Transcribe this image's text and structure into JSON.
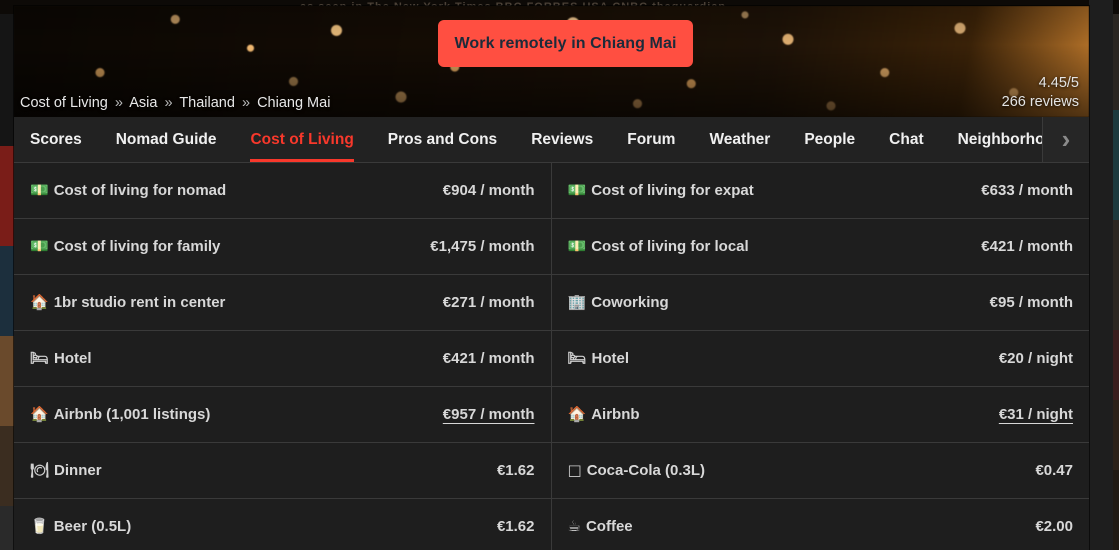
{
  "background": {
    "press_logos": "as seen in   The New York Times   BBC   FORBES   USA   CNBC   theguardian"
  },
  "hero": {
    "cta_label": "Work remotely in Chiang Mai",
    "cta_color": "#ff4f41",
    "breadcrumb": [
      {
        "label": "Cost of Living"
      },
      {
        "label": "Asia"
      },
      {
        "label": "Thailand"
      },
      {
        "label": "Chiang Mai"
      }
    ],
    "breadcrumb_separator": "»",
    "rating_score": "4.45/5",
    "rating_reviews": "266 reviews"
  },
  "tabs": {
    "accent_color": "#f8382b",
    "items": [
      {
        "label": "Scores",
        "active": false
      },
      {
        "label": "Nomad Guide",
        "active": false
      },
      {
        "label": "Cost of Living",
        "active": true
      },
      {
        "label": "Pros and Cons",
        "active": false
      },
      {
        "label": "Reviews",
        "active": false
      },
      {
        "label": "Forum",
        "active": false
      },
      {
        "label": "Weather",
        "active": false
      },
      {
        "label": "People",
        "active": false
      },
      {
        "label": "Chat",
        "active": false
      },
      {
        "label": "Neighborhoods",
        "active": false
      }
    ],
    "next_icon": "chevron-right-icon",
    "next_glyph": "›"
  },
  "cost_table": {
    "rows": [
      {
        "column": "left",
        "icon": "money-banknote-icon",
        "glyph": "💵",
        "label": "Cost of living for nomad",
        "value": "€904 / month",
        "link": false
      },
      {
        "column": "right",
        "icon": "money-banknote-icon",
        "glyph": "💵",
        "label": "Cost of living for expat",
        "value": "€633 / month",
        "link": false
      },
      {
        "column": "left",
        "icon": "money-banknote-icon",
        "glyph": "💵",
        "label": "Cost of living for family",
        "value": "€1,475 / month",
        "link": false
      },
      {
        "column": "right",
        "icon": "money-banknote-icon",
        "glyph": "💵",
        "label": "Cost of living for local",
        "value": "€421 / month",
        "link": false
      },
      {
        "column": "left",
        "icon": "house-icon",
        "glyph": "🏠",
        "label": "1br studio rent in center",
        "value": "€271 / month",
        "link": false
      },
      {
        "column": "right",
        "icon": "office-building-icon",
        "glyph": "🏢",
        "label": "Coworking",
        "value": "€95 / month",
        "link": false
      },
      {
        "column": "left",
        "icon": "bed-icon",
        "glyph": "🛏",
        "label": "Hotel",
        "value": "€421 / month",
        "link": false
      },
      {
        "column": "right",
        "icon": "bed-icon",
        "glyph": "🛏",
        "label": "Hotel",
        "value": "€20 / night",
        "link": false
      },
      {
        "column": "left",
        "icon": "house-icon",
        "glyph": "🏠",
        "label": "Airbnb (1,001 listings)",
        "value": "€957 / month",
        "link": true
      },
      {
        "column": "right",
        "icon": "house-icon",
        "glyph": "🏠",
        "label": "Airbnb",
        "value": "€31 / night",
        "link": true
      },
      {
        "column": "left",
        "icon": "dinner-plate-icon",
        "glyph": "🍽",
        "label": "Dinner",
        "value": "€1.62",
        "link": false
      },
      {
        "column": "right",
        "icon": "cola-glass-icon",
        "glyph": "□",
        "label": "Coca-Cola (0.3L)",
        "value": "€0.47",
        "link": false
      },
      {
        "column": "left",
        "icon": "beer-glass-icon",
        "glyph": "🥛",
        "label": "Beer (0.5L)",
        "value": "€1.62",
        "link": false
      },
      {
        "column": "right",
        "icon": "coffee-cup-icon",
        "glyph": "☕",
        "label": "Coffee",
        "value": "€2.00",
        "link": false
      }
    ]
  }
}
